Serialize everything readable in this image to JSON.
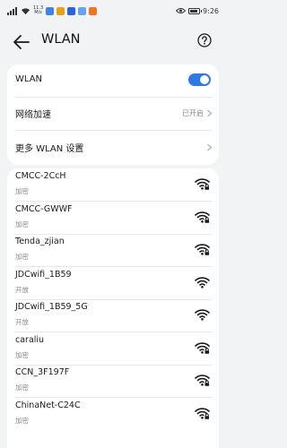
{
  "statusbar": {
    "speed_value": "11.3",
    "speed_unit": "M/s",
    "time": "9:26",
    "app_icon_colors": [
      "#3b82f6",
      "#f59e0b",
      "#2563eb",
      "#60a5fa",
      "#f97316"
    ]
  },
  "header": {
    "title": "WLAN",
    "back_icon": "arrow-left-icon",
    "help_icon": "question-circle-icon"
  },
  "settings": {
    "wlan_label": "WLAN",
    "wlan_enabled": true,
    "accel_label": "网络加速",
    "accel_value": "已开启",
    "more_label": "更多 WLAN 设置"
  },
  "accent_color": "#2a79ee",
  "networks": [
    {
      "name": "CMCC-2CcH",
      "security": "加密",
      "locked": true
    },
    {
      "name": "CMCC-GWWF",
      "security": "加密",
      "locked": true
    },
    {
      "name": "Tenda_zjian",
      "security": "加密",
      "locked": true
    },
    {
      "name": "JDCwifi_1B59",
      "security": "开放",
      "locked": false
    },
    {
      "name": "JDCwifi_1B59_5G",
      "security": "开放",
      "locked": false
    },
    {
      "name": "caraliu",
      "security": "加密",
      "locked": true
    },
    {
      "name": "CCN_3F197F",
      "security": "加密",
      "locked": true
    },
    {
      "name": "ChinaNet-C24C",
      "security": "加密",
      "locked": true
    }
  ]
}
